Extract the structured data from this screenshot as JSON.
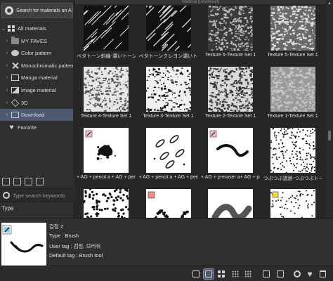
{
  "grid": {
    "header": "Material [Download]"
  },
  "assets_button": {
    "label": "Search for materials on ASSETS",
    "icon": "gear-icon"
  },
  "tree": [
    {
      "label": "All materials",
      "icon": "grid-icon",
      "chevron": "⌄",
      "indent": 0
    },
    {
      "label": "MY FAVES",
      "icon": "folder-icon",
      "chevron": "›",
      "indent": 1
    },
    {
      "label": "Color pattern",
      "icon": "palette-icon",
      "chevron": "›",
      "indent": 1
    },
    {
      "label": "Monochromatic pattern",
      "icon": "monochromatic-icon",
      "chevron": "›",
      "indent": 1
    },
    {
      "label": "Manga material",
      "icon": "manga-icon",
      "chevron": "›",
      "indent": 1
    },
    {
      "label": "Image material",
      "icon": "image-icon",
      "chevron": "›",
      "indent": 1
    },
    {
      "label": "3D",
      "icon": "cube-icon",
      "chevron": "›",
      "indent": 1
    },
    {
      "label": "Download",
      "icon": "download-folder-icon",
      "chevron": "›",
      "indent": 1,
      "selected": true
    },
    {
      "label": "Favorite",
      "icon": "heart-icon",
      "chevron": "",
      "indent": 0
    }
  ],
  "search": {
    "placeholder": "Type search keywords"
  },
  "type_label": "Type",
  "materials": [
    {
      "caption": "ベタトーン斜線-濃いトーン-手書き",
      "pattern": "diag-dense"
    },
    {
      "caption": "ベタトーンクレヨン濃いトーン-手書き",
      "pattern": "crayon"
    },
    {
      "caption": "Texture 6-Texture Set 1",
      "pattern": "noise-dark"
    },
    {
      "caption": "Texture 5-Texture Set 1",
      "pattern": "noise-mid"
    },
    {
      "caption": "Texture 4-Texture Set 1",
      "pattern": "noise-light"
    },
    {
      "caption": "Texture 3-Texture Set 1",
      "pattern": "noise-blotch"
    },
    {
      "caption": "Texture 2-Texture Set 1",
      "pattern": "noise-fine"
    },
    {
      "caption": "Texture 1-Texture Set 1",
      "pattern": "noise-grey"
    },
    {
      "caption": "+ AG + pencil a + AG + pencil a",
      "pattern": "brush-splat"
    },
    {
      "caption": "+ AG + pencil a + AG + pencil a",
      "pattern": "brush-ovals"
    },
    {
      "caption": "+ AG + p-eraser a+ AG + pencil a",
      "pattern": "brush-stroke"
    },
    {
      "caption": "つぶつぶ透過-つぶつぶトーンセペン",
      "pattern": "dots"
    },
    {
      "caption": "",
      "pattern": "dots-big"
    },
    {
      "caption": "",
      "pattern": "brush-rope"
    },
    {
      "caption": "",
      "pattern": "brush-thick"
    },
    {
      "caption": "",
      "pattern": "speckle"
    }
  ],
  "details": {
    "name": "검정 2",
    "type": "Type : Brush",
    "user_tag": "User tag : 검정, 브러쉬",
    "default_tag": "Default tag : Brush tool"
  },
  "bottom_toolbar": [
    {
      "icon": "check-square-icon",
      "active": false
    },
    {
      "icon": "list-view-icon",
      "active": true
    },
    {
      "icon": "grid-large-icon",
      "active": false
    },
    {
      "icon": "grid-small-icon",
      "active": false
    },
    {
      "icon": "grid-tiny-icon",
      "active": false
    },
    {
      "icon": "paste-icon",
      "active": false
    },
    {
      "icon": "copy-disabled-icon",
      "active": false
    },
    {
      "icon": "settings-icon",
      "active": false
    },
    {
      "icon": "favorite-heart-icon",
      "active": false
    },
    {
      "icon": "trash-icon",
      "active": false
    }
  ]
}
